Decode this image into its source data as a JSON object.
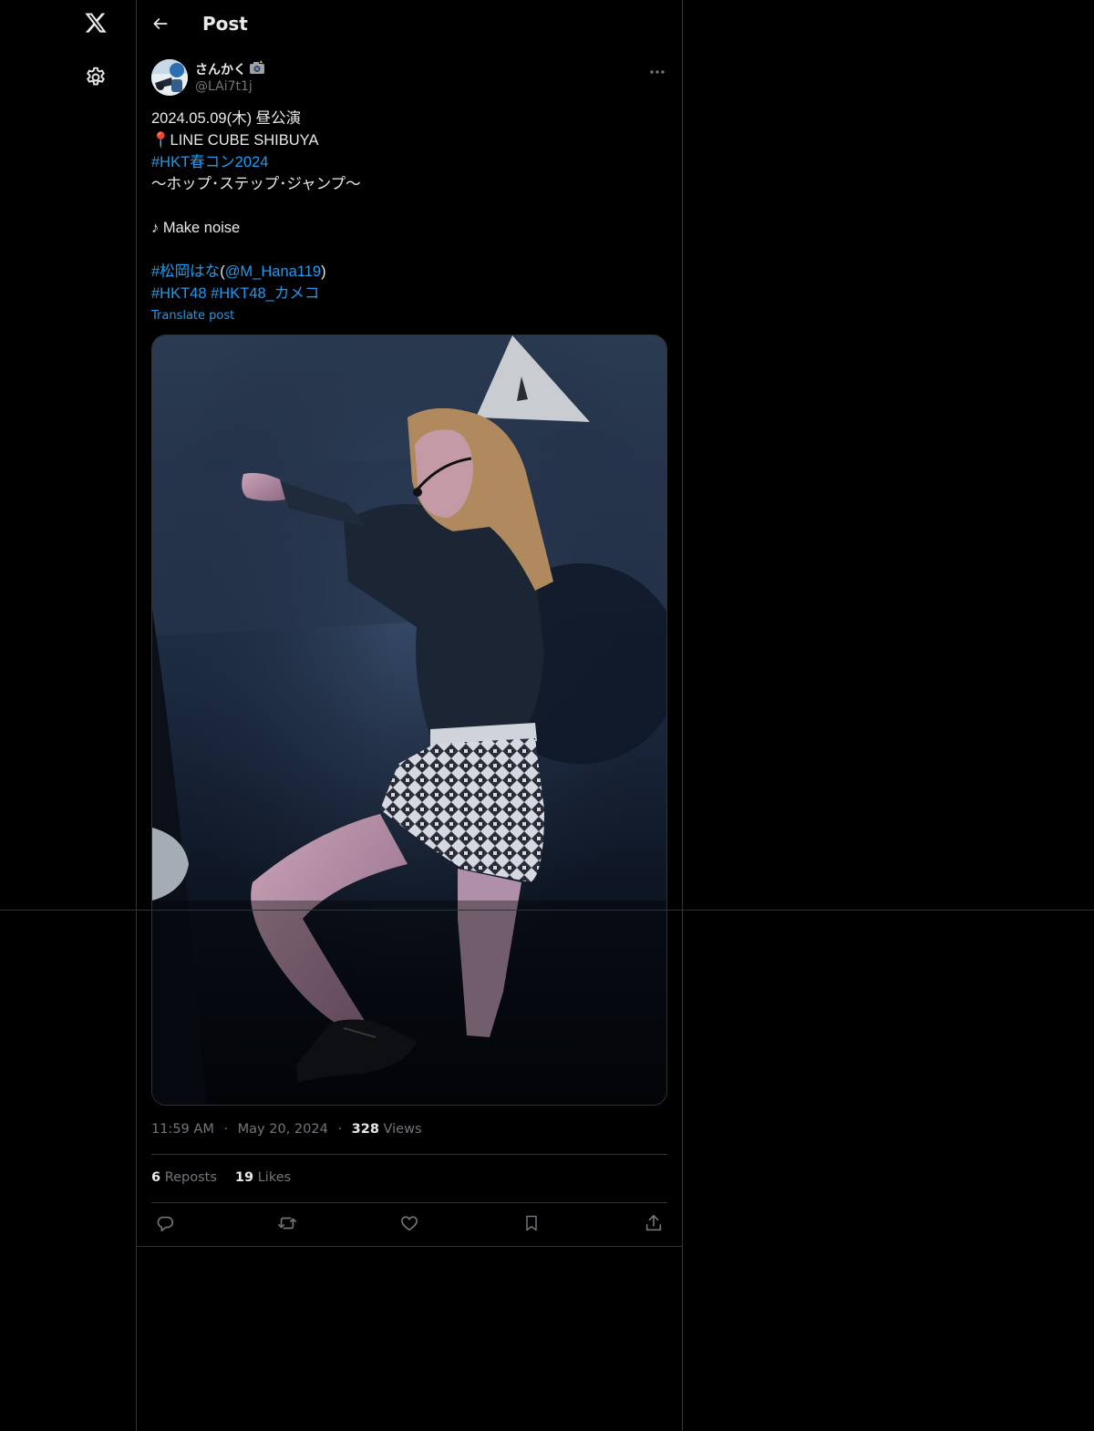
{
  "nav": {
    "logo_icon": "x-logo-icon",
    "settings_icon": "gear-icon"
  },
  "header": {
    "back_icon": "arrow-left-icon",
    "title": "Post"
  },
  "author": {
    "display_name": "さんかく",
    "name_emoji": "camera-with-flash-icon",
    "handle": "@LAi7t1j"
  },
  "post": {
    "lines": [
      [
        {
          "text": "2024.05.09(木) 昼公演",
          "link": false
        }
      ],
      [
        {
          "text": "📍LINE CUBE SHIBUYA",
          "link": false
        }
      ],
      [
        {
          "text": "#HKT春コン2024",
          "link": true
        }
      ],
      [
        {
          "text": "〜ホップ･ステップ･ジャンプ〜",
          "link": false
        }
      ],
      [],
      [
        {
          "text": "♪ Make noise",
          "link": false
        }
      ],
      [],
      [
        {
          "text": "#松岡はな",
          "link": true
        },
        {
          "text": "(",
          "link": false
        },
        {
          "text": "@M_Hana119",
          "link": true
        },
        {
          "text": ")",
          "link": false
        }
      ],
      [
        {
          "text": "#HKT48",
          "link": true
        },
        {
          "text": " ",
          "link": false
        },
        {
          "text": "#HKT48_カメコ",
          "link": true
        }
      ]
    ],
    "translate_label": "Translate post"
  },
  "meta": {
    "time": "11:59 AM",
    "dot": "·",
    "date": "May 20, 2024",
    "views_count": "328",
    "views_label": " Views"
  },
  "stats": {
    "reposts_count": "6",
    "reposts_label": " Reposts",
    "likes_count": "19",
    "likes_label": " Likes"
  },
  "actions": [
    "reply-icon",
    "repost-icon",
    "like-icon",
    "bookmark-icon",
    "share-icon"
  ],
  "colors": {
    "background": "#000000",
    "text": "#e7e9ea",
    "muted": "#71767b",
    "link": "#1d9bf0",
    "border": "#2f3336"
  }
}
